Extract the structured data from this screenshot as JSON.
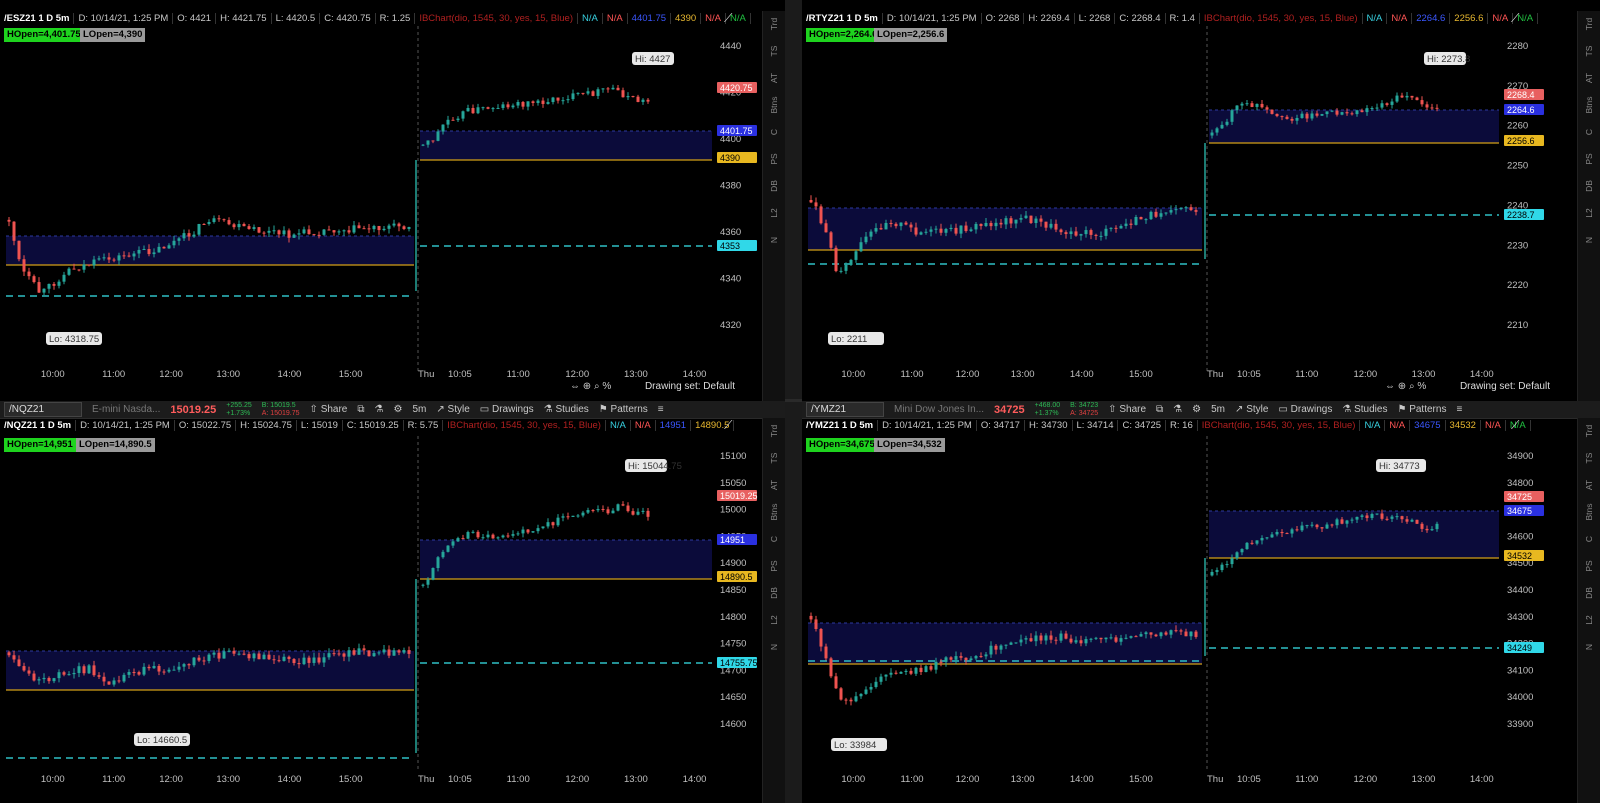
{
  "colors": {
    "green_candle": "#26a69a",
    "red_candle": "#ef5350",
    "open_line": "#d4a017",
    "cyan_dash": "#2fbfc6",
    "shade": "#0b0b3a",
    "bg": "#000000"
  },
  "panels": [
    {
      "toolbar": null,
      "header": {
        "symbol": "/ESZ21 1 D 5m",
        "date": "D: 10/14/21, 1:25 PM",
        "open": "O: 4421",
        "high": "H: 4421.75",
        "low": "L: 4420.5",
        "close": "C: 4420.75",
        "range": "R: 1.25",
        "study": "IBChart(dio, 1545, 30, yes, 15, Blue)",
        "na1": "N/A",
        "na2": "N/A",
        "val1": "4401.75",
        "val2": "4390",
        "na3": "N/A",
        "na4": "N/A"
      },
      "badges": {
        "hopen": "HOpen=4,401.75",
        "lopen": "LOpen=4,390"
      },
      "prices": {
        "last": "4420.75",
        "hopen": "4401.75",
        "lopen": "4390",
        "cyan": "4353"
      },
      "yticks": [
        "4440",
        "4420",
        "4400",
        "4380",
        "4360",
        "4340",
        "4320"
      ],
      "xticks": [
        "10:00",
        "11:00",
        "12:00",
        "13:00",
        "14:00",
        "15:00",
        "Thu",
        "10:05",
        "11:00",
        "12:00",
        "13:00",
        "14:00"
      ],
      "hi_label": "Hi: 4427",
      "lo_label": "Lo: 4318.75",
      "footer": {
        "drawing_set": "Drawing set: Default"
      }
    },
    {
      "toolbar": null,
      "header": {
        "symbol": "/RTYZ21 1 D 5m",
        "date": "D: 10/14/21, 1:25 PM",
        "open": "O: 2268",
        "high": "H: 2269.4",
        "low": "L: 2268",
        "close": "C: 2268.4",
        "range": "R: 1.4",
        "study": "IBChart(dio, 1545, 30, yes, 15, Blue)",
        "na1": "N/A",
        "na2": "N/A",
        "val1": "2264.6",
        "val2": "2256.6",
        "na3": "N/A",
        "na4": "N/A"
      },
      "badges": {
        "hopen": "HOpen=2,264.6",
        "lopen": "LOpen=2,256.6"
      },
      "prices": {
        "last": "2268.4",
        "hopen": "2264.6",
        "lopen": "2256.6",
        "cyan": "2238.7"
      },
      "yticks": [
        "2280",
        "2270",
        "2260",
        "2250",
        "2240",
        "2230",
        "2220",
        "2210"
      ],
      "xticks": [
        "10:00",
        "11:00",
        "12:00",
        "13:00",
        "14:00",
        "15:00",
        "Thu",
        "10:05",
        "11:00",
        "12:00",
        "13:00",
        "14:00"
      ],
      "hi_label": "Hi: 2273.8",
      "lo_label": "Lo: 2211",
      "footer": {
        "drawing_set": "Drawing set: Default"
      }
    },
    {
      "toolbar": {
        "symbol": "/NQZ21",
        "name": "E-mini Nasda...",
        "price": "15019.25",
        "change": "+255.25",
        "change_pct": "+1.73%",
        "bid": "B: 15019.5",
        "ask": "A: 15019.75",
        "share": "Share",
        "timeframe": "5m",
        "style": "Style",
        "drawings": "Drawings",
        "studies": "Studies",
        "patterns": "Patterns"
      },
      "header": {
        "symbol": "/NQZ21 1 D 5m",
        "date": "D: 10/14/21, 1:25 PM",
        "open": "O: 15022.75",
        "high": "H: 15024.75",
        "low": "L: 15019",
        "close": "C: 15019.25",
        "range": "R: 5.75",
        "study": "IBChart(dio, 1545, 30, yes, 15, Blue)",
        "na1": "N/A",
        "na2": "N/A",
        "val1": "14951",
        "val2": "14890.5",
        "na3": "",
        "na4": ""
      },
      "badges": {
        "hopen": "HOpen=14,951",
        "lopen": "LOpen=14,890.5"
      },
      "prices": {
        "last": "15019.25",
        "hopen": "14951",
        "lopen": "14890.5",
        "cyan": "14755.75"
      },
      "yticks": [
        "15100",
        "15050",
        "15000",
        "14950",
        "14900",
        "14850",
        "14800",
        "14750",
        "14700",
        "14650",
        "14600"
      ],
      "xticks": [
        "10:00",
        "11:00",
        "12:00",
        "13:00",
        "14:00",
        "15:00",
        "Thu",
        "10:05",
        "11:00",
        "12:00",
        "13:00",
        "14:00"
      ],
      "hi_label": "Hi: 15044.75",
      "lo_label": "Lo: 14660.5",
      "footer": null
    },
    {
      "toolbar": {
        "symbol": "/YMZ21",
        "name": "Mini Dow Jones In...",
        "price": "34725",
        "change": "+468.00",
        "change_pct": "+1.37%",
        "bid": "B: 34723",
        "ask": "A: 34725",
        "share": "Share",
        "timeframe": "5m",
        "style": "Style",
        "drawings": "Drawings",
        "studies": "Studies",
        "patterns": "Patterns"
      },
      "header": {
        "symbol": "/YMZ21 1 D 5m",
        "date": "D: 10/14/21, 1:25 PM",
        "open": "O: 34717",
        "high": "H: 34730",
        "low": "L: 34714",
        "close": "C: 34725",
        "range": "R: 16",
        "study": "IBChart(dio, 1545, 30, yes, 15, Blue)",
        "na1": "N/A",
        "na2": "N/A",
        "val1": "34675",
        "val2": "34532",
        "na3": "N/A",
        "na4": "N/A"
      },
      "badges": {
        "hopen": "HOpen=34,675",
        "lopen": "LOpen=34,532"
      },
      "prices": {
        "last": "34725",
        "hopen": "34675",
        "lopen": "34532",
        "cyan": "34249"
      },
      "yticks": [
        "34900",
        "34800",
        "34700",
        "34600",
        "34500",
        "34400",
        "34300",
        "34200",
        "34100",
        "34000",
        "33900"
      ],
      "xticks": [
        "10:00",
        "11:00",
        "12:00",
        "13:00",
        "14:00",
        "15:00",
        "Thu",
        "10:05",
        "11:00",
        "12:00",
        "13:00",
        "14:00"
      ],
      "hi_label": "Hi: 34773",
      "lo_label": "Lo: 33984",
      "footer": null
    }
  ],
  "sidebar_items": [
    "Trd",
    "TS",
    "AT",
    "Btns",
    "C",
    "PS",
    "DB",
    "L2",
    "N"
  ]
}
